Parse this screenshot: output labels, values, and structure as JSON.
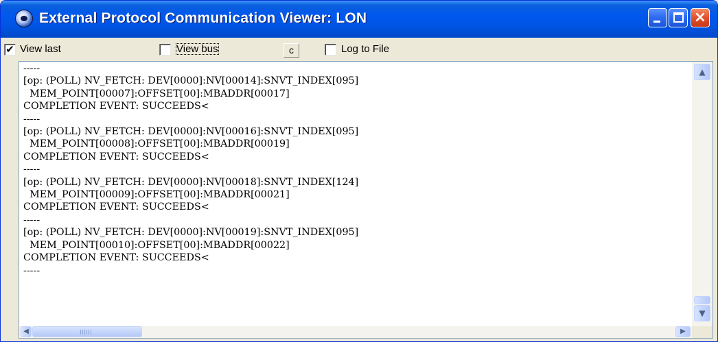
{
  "window": {
    "title": "External Protocol Communication Viewer: LON",
    "close_glyph": "×"
  },
  "toolbar": {
    "view_last": {
      "label": "View last",
      "checked": true,
      "mark": "✔"
    },
    "view_bus": {
      "label": "View bus",
      "checked": false,
      "mark": ""
    },
    "c_button_label": "c",
    "log_to_file": {
      "label": "Log to File",
      "checked": false,
      "mark": ""
    }
  },
  "log": {
    "lines": [
      "-----",
      "[op: (POLL) NV_FETCH: DEV[0000]:NV[00014]:SNVT_INDEX[095]",
      "  MEM_POINT[00007]:OFFSET[00]:MBADDR[00017]",
      "COMPLETION EVENT: SUCCEEDS<",
      "-----",
      "[op: (POLL) NV_FETCH: DEV[0000]:NV[00016]:SNVT_INDEX[095]",
      "  MEM_POINT[00008]:OFFSET[00]:MBADDR[00019]",
      "COMPLETION EVENT: SUCCEEDS<",
      "-----",
      "[op: (POLL) NV_FETCH: DEV[0000]:NV[00018]:SNVT_INDEX[124]",
      "  MEM_POINT[00009]:OFFSET[00]:MBADDR[00021]",
      "COMPLETION EVENT: SUCCEEDS<",
      "-----",
      "[op: (POLL) NV_FETCH: DEV[0000]:NV[00019]:SNVT_INDEX[095]",
      "  MEM_POINT[00010]:OFFSET[00]:MBADDR[00022]",
      "COMPLETION EVENT: SUCCEEDS<",
      "-----"
    ]
  },
  "scrollbars": {
    "up_glyph": "▲",
    "down_glyph": "▼",
    "left_glyph": "◀",
    "right_glyph": "▶"
  }
}
